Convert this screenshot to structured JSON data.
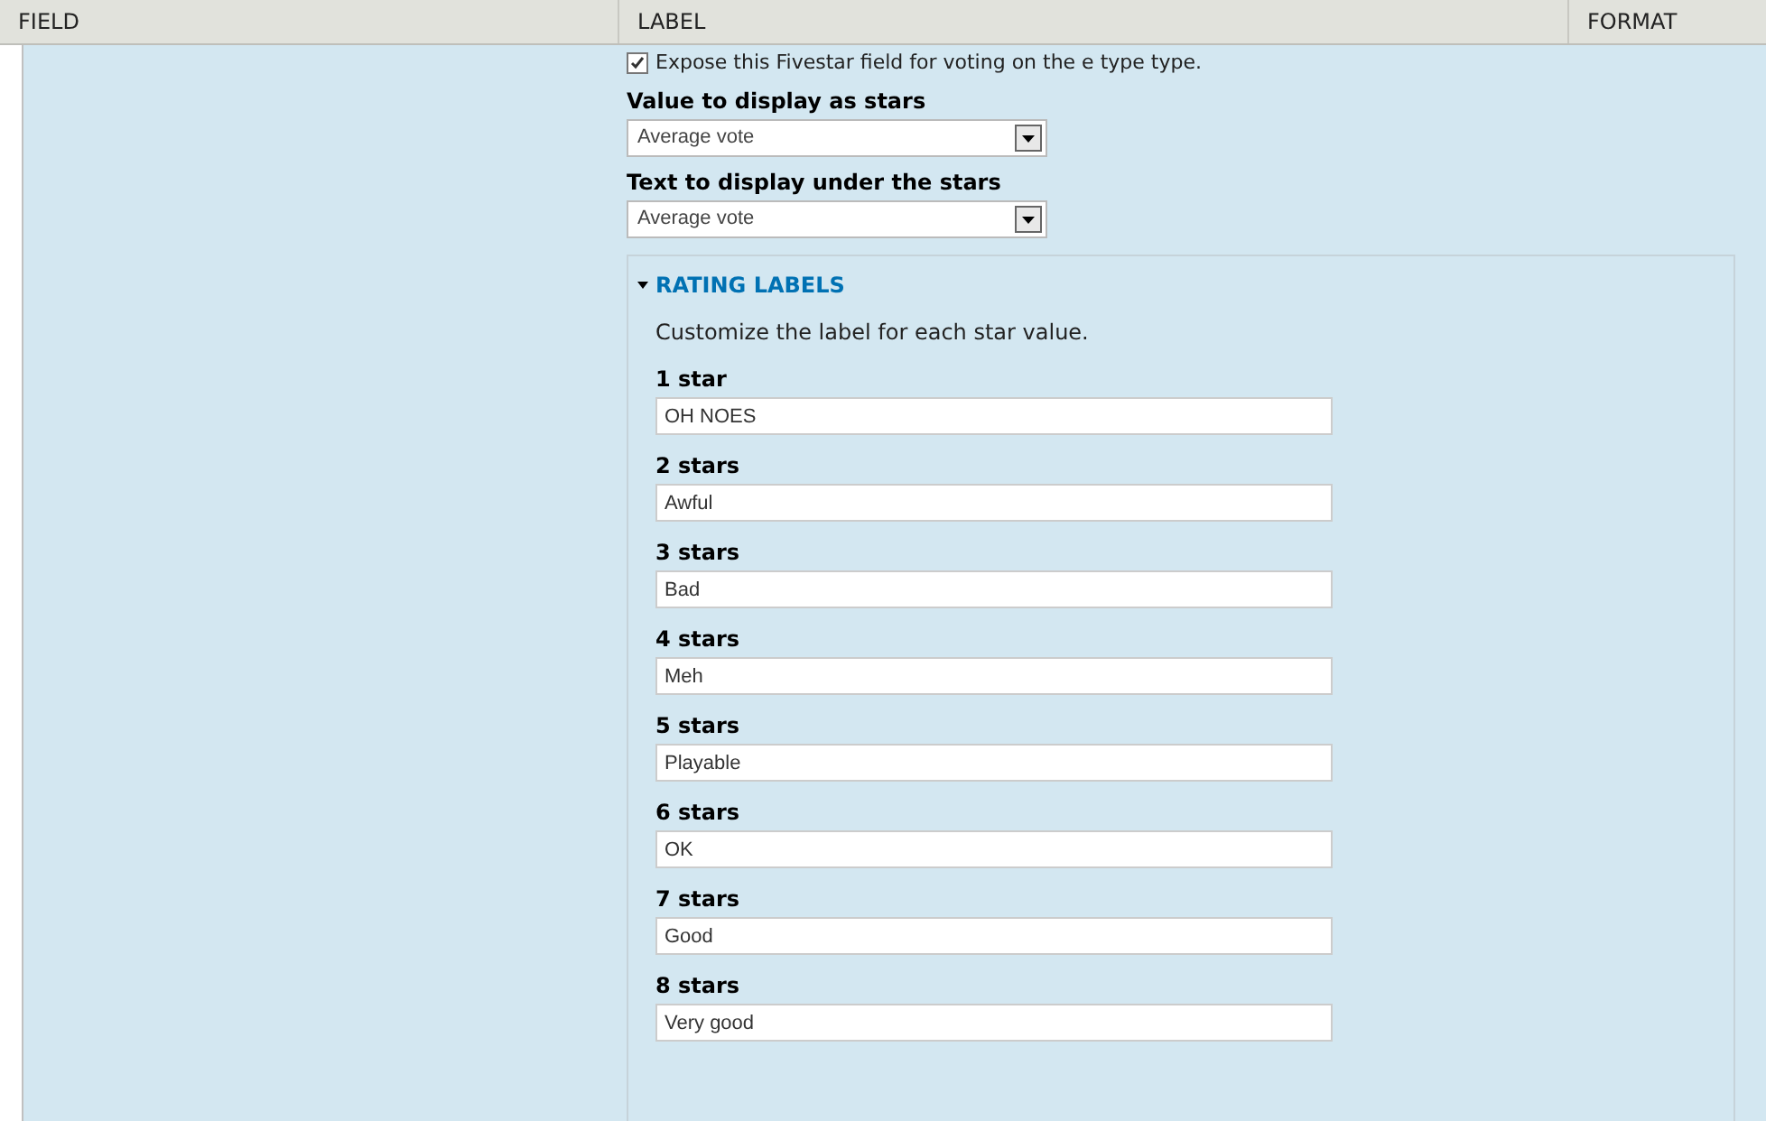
{
  "table": {
    "columns": [
      "FIELD",
      "LABEL",
      "FORMAT"
    ]
  },
  "expose": {
    "label": "Expose this Fivestar field for voting on the e type type.",
    "checked": true
  },
  "selects": [
    {
      "label": "Value to display as stars",
      "value": "Average vote"
    },
    {
      "label": "Text to display under the stars",
      "value": "Average vote"
    }
  ],
  "fieldset": {
    "title": "RATING LABELS",
    "expanded": true,
    "description": "Customize the label for each star value.",
    "fields": [
      {
        "label": "1 star",
        "value": "OH NOES"
      },
      {
        "label": "2 stars",
        "value": "Awful"
      },
      {
        "label": "3 stars",
        "value": "Bad"
      },
      {
        "label": "4 stars",
        "value": "Meh"
      },
      {
        "label": "5 stars",
        "value": "Playable"
      },
      {
        "label": "6 stars",
        "value": "OK"
      },
      {
        "label": "7 stars",
        "value": "Good"
      },
      {
        "label": "8 stars",
        "value": "Very good"
      }
    ]
  }
}
